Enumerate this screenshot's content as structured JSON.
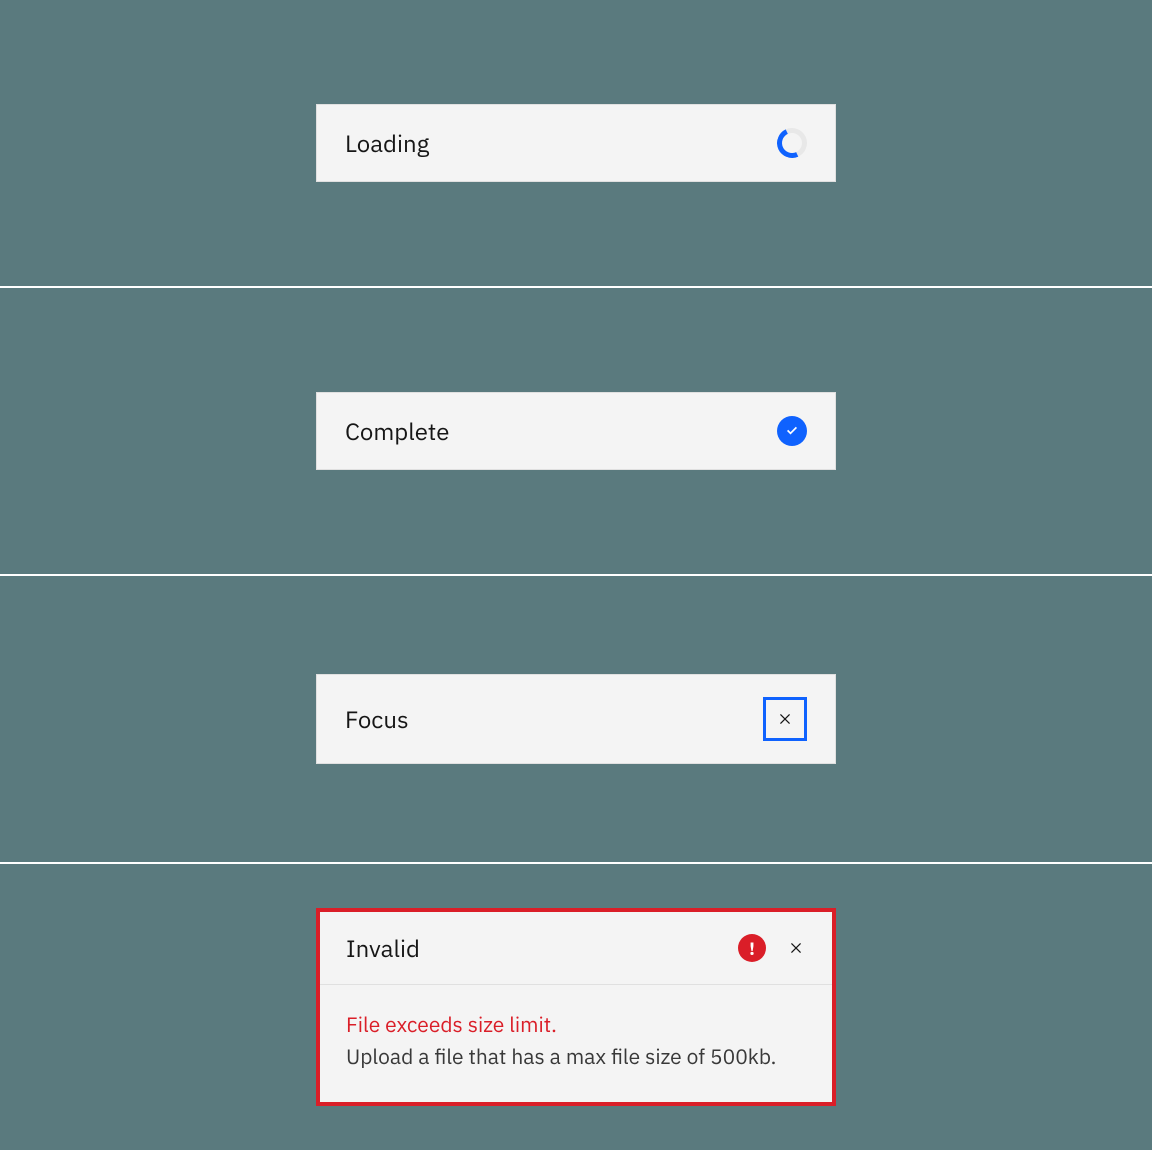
{
  "states": {
    "loading": {
      "label": "Loading"
    },
    "complete": {
      "label": "Complete"
    },
    "focus": {
      "label": "Focus"
    },
    "invalid": {
      "label": "Invalid",
      "error_title": "File exceeds size limit.",
      "error_message": "Upload a file that has a max file size of 500kb."
    }
  },
  "colors": {
    "brand": "#0f62fe",
    "danger": "#da1e28",
    "surface": "#f4f4f4",
    "backdrop": "#5a7a7e"
  }
}
